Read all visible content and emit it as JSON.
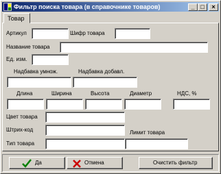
{
  "window": {
    "title": "Фильтр поиска товара (в справочнике товаров)"
  },
  "controls": {
    "minimize": "_",
    "maximize": "□",
    "close": "×"
  },
  "tabs": [
    {
      "label": "Товар"
    }
  ],
  "form": {
    "artikul": {
      "label": "Артикул",
      "value": ""
    },
    "shifr": {
      "label": "Шифр товара",
      "value": ""
    },
    "name": {
      "label": "Название товара",
      "value": ""
    },
    "unit": {
      "label": "Ед. изм.",
      "value": ""
    },
    "markup_mult": {
      "label": "Надбавка умнож.",
      "value": ""
    },
    "markup_add": {
      "label": "Надбавка добавл.",
      "value": ""
    },
    "length": {
      "label": "Длина",
      "value": ""
    },
    "width": {
      "label": "Ширина",
      "value": ""
    },
    "height": {
      "label": "Высота",
      "value": ""
    },
    "diameter": {
      "label": "Диаметр",
      "value": ""
    },
    "vat": {
      "label": "НДС, %",
      "value": ""
    },
    "color": {
      "label": "Цвет товара",
      "value": ""
    },
    "barcode": {
      "label": "Штрих-код",
      "value": ""
    },
    "type": {
      "label": "Тип товара",
      "value": ""
    },
    "limit": {
      "label": "Лимит товара",
      "value": ""
    }
  },
  "buttons": {
    "ok": "Да",
    "cancel": "Отмена",
    "clear": "Очистить фильтр"
  },
  "colors": {
    "titlebar_start": "#0a246a",
    "titlebar_end": "#a6caf0",
    "ok_check": "#008000",
    "cancel_x": "#cc0000"
  },
  "icons": {
    "title": "window-app-icon",
    "ok": "check-icon",
    "cancel": "x-icon"
  }
}
